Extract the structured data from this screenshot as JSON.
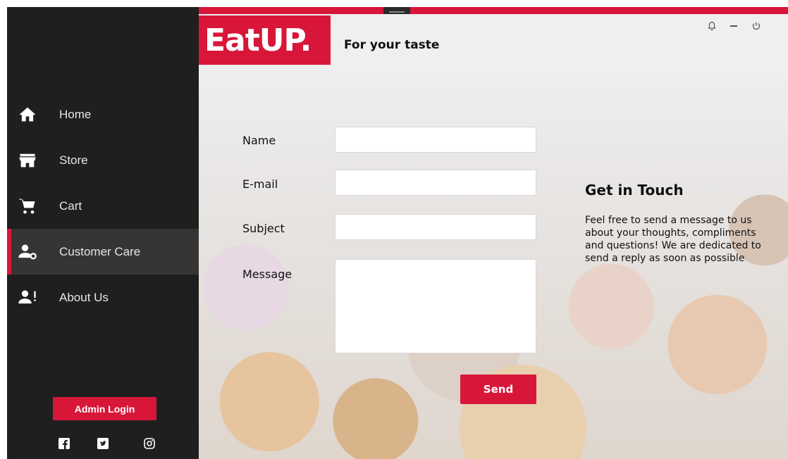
{
  "app": {
    "logo": "EatUP.",
    "tagline": "For your taste",
    "accent_color": "#d8163a"
  },
  "window_controls": [
    {
      "icon": "bell-icon"
    },
    {
      "icon": "minimize-icon"
    },
    {
      "icon": "power-icon"
    }
  ],
  "sidebar": {
    "items": [
      {
        "label": "Home",
        "icon": "home-icon",
        "active": false
      },
      {
        "label": "Store",
        "icon": "store-icon",
        "active": false
      },
      {
        "label": "Cart",
        "icon": "cart-icon",
        "active": false
      },
      {
        "label": "Customer Care",
        "icon": "customer-care-icon",
        "active": true
      },
      {
        "label": "About Us",
        "icon": "about-us-icon",
        "active": false
      }
    ],
    "admin_login_label": "Admin Login",
    "social": [
      {
        "icon": "facebook-icon"
      },
      {
        "icon": "twitter-icon"
      },
      {
        "icon": "instagram-icon"
      }
    ]
  },
  "form": {
    "name_label": "Name",
    "name_value": "",
    "email_label": "E-mail",
    "email_value": "",
    "subject_label": "Subject",
    "subject_value": "",
    "message_label": "Message",
    "message_value": "",
    "send_label": "Send"
  },
  "contact": {
    "title": "Get in Touch",
    "text": "Feel free to send a message to us about your thoughts, compliments and questions! We are dedicated to send a reply as soon as possible"
  }
}
